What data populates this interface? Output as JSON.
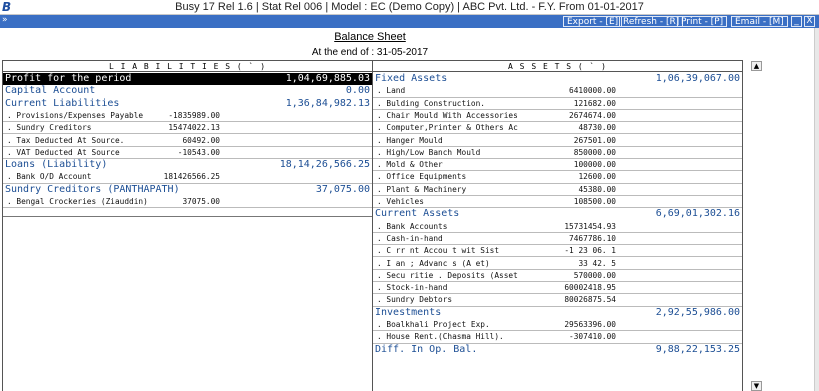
{
  "app": {
    "logo": "B",
    "title": "Busy 17  Rel 1.6  |  Stat Rel 006  |  Model : EC (Demo Copy)  |  ABC Pvt. Ltd. - F.Y. From 01-01-2017"
  },
  "toolbar": {
    "arrow": "»",
    "buttons": [
      "Export - [E]",
      "Refresh - [R]",
      "Print - [P]",
      "Email - [M]"
    ],
    "window_controls": [
      "_",
      "X"
    ]
  },
  "report": {
    "title": "Balance Sheet",
    "subtitle": "At the end of : 31-05-2017",
    "liabilities_header": "L I A B I L I T I E S  ( ` )",
    "assets_header": "A S S E T S  ( ` )"
  },
  "liabilities": [
    {
      "kind": "group",
      "label": "Profit for the period",
      "amount": "1,04,69,885.03",
      "highlight": true
    },
    {
      "kind": "group",
      "label": "Capital Account",
      "amount": "0.00"
    },
    {
      "kind": "group",
      "label": "Current Liabilities",
      "amount": "1,36,84,982.13"
    },
    {
      "kind": "item",
      "label": ". Provisions/Expenses Payable",
      "amount": "-1835989.00"
    },
    {
      "kind": "item",
      "label": ". Sundry Creditors",
      "amount": "15474022.13"
    },
    {
      "kind": "item",
      "label": ". Tax Deducted At Source.",
      "amount": "60492.00"
    },
    {
      "kind": "item",
      "label": ". VAT Deducted At Source",
      "amount": "-10543.00"
    },
    {
      "kind": "group",
      "label": "Loans (Liability)",
      "amount": "18,14,26,566.25"
    },
    {
      "kind": "item",
      "label": ". Bank O/D Account",
      "amount": "181426566.25"
    },
    {
      "kind": "group",
      "label": "Sundry Creditors (PANTHAPATH)",
      "amount": "37,075.00"
    },
    {
      "kind": "item",
      "label": ". Bengal Crockeries (Ziauddin)",
      "amount": "37075.00"
    }
  ],
  "assets": [
    {
      "kind": "group",
      "label": "Fixed Assets",
      "amount": "1,06,39,067.00"
    },
    {
      "kind": "item",
      "label": ". Land",
      "amount": "6410000.00"
    },
    {
      "kind": "item",
      "label": ". Bulding Construction.",
      "amount": "121682.00"
    },
    {
      "kind": "item",
      "label": ". Chair Mould With Accessories",
      "amount": "2674674.00"
    },
    {
      "kind": "item",
      "label": ". Computer,Printer & Others Ac",
      "amount": "48730.00"
    },
    {
      "kind": "item",
      "label": ". Hanger Mould",
      "amount": "267501.00"
    },
    {
      "kind": "item",
      "label": ". High/Low Banch Mould",
      "amount": "850000.00"
    },
    {
      "kind": "item",
      "label": ". Mold & Other",
      "amount": "100000.00"
    },
    {
      "kind": "item",
      "label": ". Office Equipments",
      "amount": "12600.00"
    },
    {
      "kind": "item",
      "label": ". Plant & Machinery",
      "amount": "45380.00"
    },
    {
      "kind": "item",
      "label": ". Vehicles",
      "amount": "108500.00"
    },
    {
      "kind": "group",
      "label": "Current Assets",
      "amount": "6,69,01,302.16"
    },
    {
      "kind": "item",
      "label": ". Bank Accounts",
      "amount": "15731454.93"
    },
    {
      "kind": "item",
      "label": ". Cash-in-hand",
      "amount": "7467786.10"
    },
    {
      "kind": "item",
      "label": ". C  rr nt Accou t wit  Sist",
      "amount": "-1 23  06. 1"
    },
    {
      "kind": "item",
      "label": ". I  an  ;  Advanc  s (A  et)",
      "amount": "33  42. 5"
    },
    {
      "kind": "item",
      "label": ". Secu ritie  .  Deposits (Asset",
      "amount": "570000.00"
    },
    {
      "kind": "item",
      "label": ". Stock-in-hand",
      "amount": "60002418.95"
    },
    {
      "kind": "item",
      "label": ". Sundry Debtors",
      "amount": "80026875.54"
    },
    {
      "kind": "group",
      "label": "Investments",
      "amount": "2,92,55,986.00"
    },
    {
      "kind": "item",
      "label": ". Boalkhali Project Exp.",
      "amount": "29563396.00"
    },
    {
      "kind": "item",
      "label": ". House Rent.(Chasma Hill).",
      "amount": "-307410.00"
    },
    {
      "kind": "group",
      "label": "Diff. In Op. Bal.",
      "amount": "9,88,22,153.25"
    }
  ],
  "scroll": {
    "up": "▲",
    "down": "▼"
  }
}
